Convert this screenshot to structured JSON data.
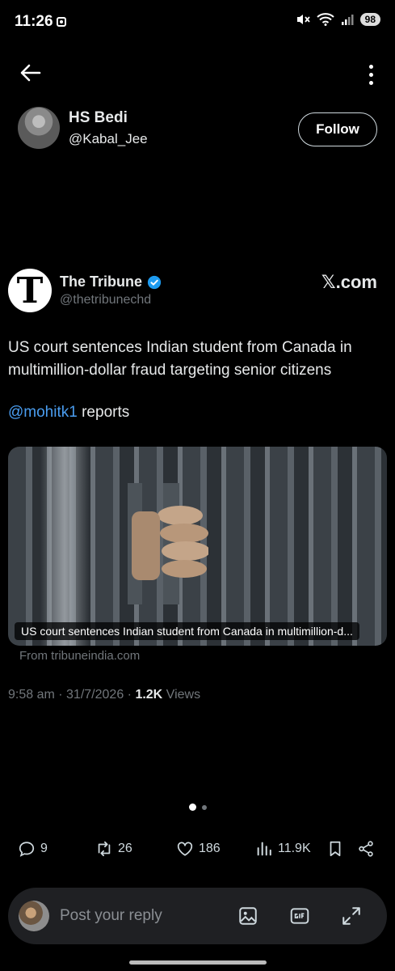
{
  "status_bar": {
    "time": "11:26",
    "battery": "98"
  },
  "profile": {
    "display_name": "HS Bedi",
    "handle": "@Kabal_Jee",
    "follow_label": "Follow"
  },
  "embed": {
    "logo_letter": "T",
    "name": "The Tribune",
    "handle": "@thetribunechd",
    "source_site": "𝕏.com",
    "text": "US court sentences Indian student from Canada in multimillion-dollar fraud targeting senior citizens",
    "mention": "@mohitk1",
    "mention_suffix": " reports",
    "card": {
      "caption": "US court sentences Indian student from Canada in multimillion-d...",
      "source": "From tribuneindia.com"
    },
    "timestamp": "9:58 am · 31/7/2026 · ",
    "views_count": "1.2K",
    "views_label": " Views"
  },
  "actions": {
    "replies": "9",
    "reposts": "26",
    "likes": "186",
    "views": "11.9K"
  },
  "reply": {
    "placeholder": "Post your reply"
  },
  "colors": {
    "background": "#000000",
    "mention": "#4a9df0",
    "verified": "#1d9bf0",
    "muted": "#71767b"
  }
}
